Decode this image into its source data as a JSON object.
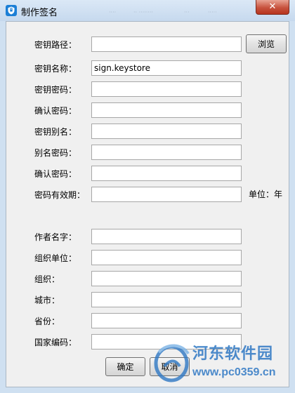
{
  "window": {
    "title": "制作签名",
    "close_label": "✕"
  },
  "form": {
    "fields": [
      {
        "label": "密钥路径：",
        "value": ""
      },
      {
        "label": "密钥名称：",
        "value": "sign.keystore"
      },
      {
        "label": "密钥密码：",
        "value": ""
      },
      {
        "label": "确认密码：",
        "value": ""
      },
      {
        "label": "密钥别名：",
        "value": ""
      },
      {
        "label": "别名密码：",
        "value": ""
      },
      {
        "label": "确认密码：",
        "value": ""
      },
      {
        "label": "密码有效期：",
        "value": ""
      },
      {
        "label": "作者名字：",
        "value": ""
      },
      {
        "label": "组织单位：",
        "value": ""
      },
      {
        "label": "组织：",
        "value": ""
      },
      {
        "label": "城市：",
        "value": ""
      },
      {
        "label": "省份：",
        "value": ""
      },
      {
        "label": "国家编码：",
        "value": ""
      }
    ],
    "browse_label": "浏览",
    "validity_unit": "单位：年"
  },
  "buttons": {
    "ok_label": "确定",
    "cancel_label": "取消"
  },
  "watermark": {
    "site_name": "河东软件园",
    "url": "www.pc0359.cn"
  },
  "colors": {
    "watermark": "#2f78c4",
    "close_button": "#c7523d",
    "titlebar": "#c6d9ee"
  }
}
